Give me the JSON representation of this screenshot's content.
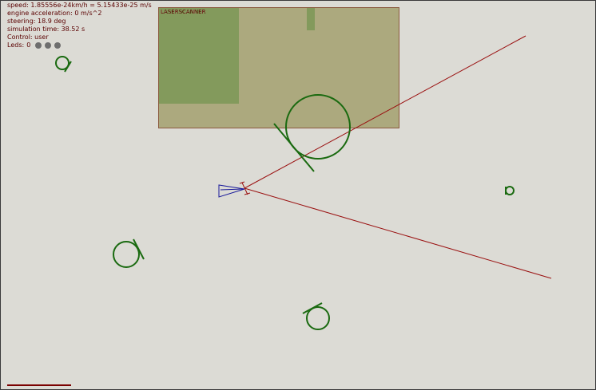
{
  "hud": {
    "speed": "speed: 1.85556e-24km/h = 5.15433e-25 m/s",
    "acceleration": "engine acceleration: 0 m/s^2",
    "steering": "steering: 18.9 deg",
    "sim_time": "simulation time: 38.52 s",
    "control": "Control: user",
    "leds_label": "Leds:",
    "leds_value": "0",
    "led_states": [
      "off",
      "off",
      "off"
    ]
  },
  "laser_panel": {
    "title": "LASERSCANNER"
  },
  "colors": {
    "background": "#dcdbd5",
    "obstacle": "#1a6a10",
    "robot": "#1a1a9a",
    "laser_ray": "#9a1010",
    "panel_bg": "#aca97e",
    "led_off": "#6e6e6e"
  },
  "icons": [
    "robot-icon",
    "laser-ray-icon",
    "obstacle-icon",
    "led-icon"
  ]
}
